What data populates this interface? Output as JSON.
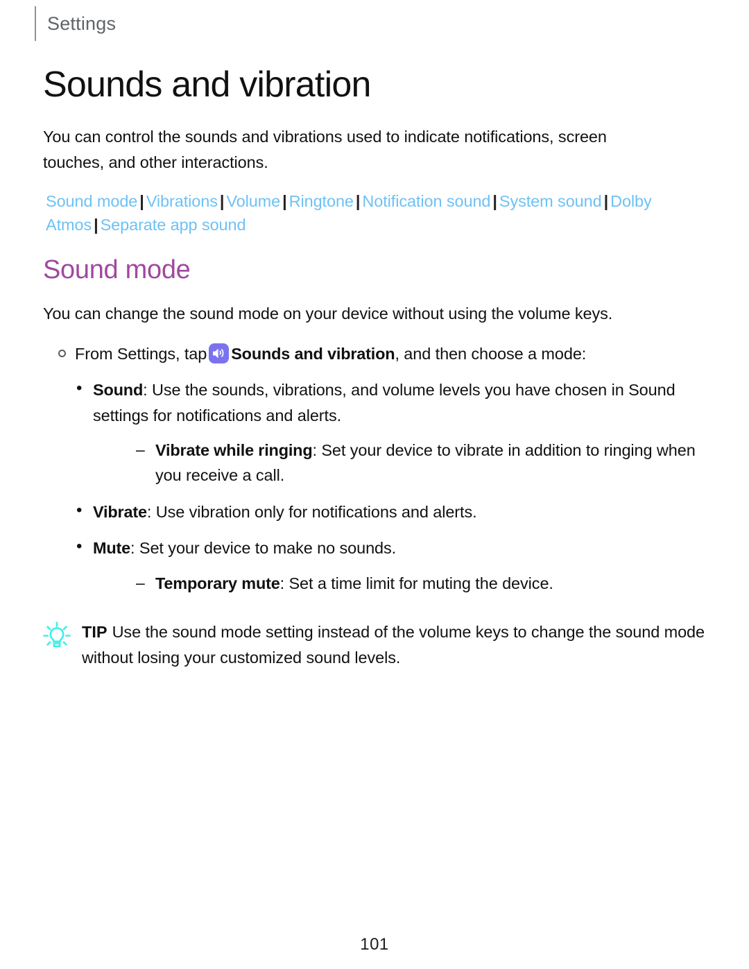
{
  "header": {
    "running_title": "Settings"
  },
  "page": {
    "title": "Sounds and vibration",
    "intro": "You can control the sounds and vibrations used to indicate notifications, screen touches, and other interactions.",
    "page_number": "101"
  },
  "section_links": {
    "separator": "|",
    "items": [
      {
        "label": "Sound mode"
      },
      {
        "label": "Vibrations"
      },
      {
        "label": "Volume"
      },
      {
        "label": "Ringtone"
      },
      {
        "label": "Notification sound"
      },
      {
        "label": "System sound"
      },
      {
        "label": "Dolby Atmos"
      },
      {
        "label": "Separate app sound"
      }
    ]
  },
  "section": {
    "heading": "Sound mode",
    "intro": "You can change the sound mode on your device without using the volume keys.",
    "step": {
      "prefix": "From Settings, tap",
      "icon_name": "sounds-and-vibration-icon",
      "bold_target": "Sounds and vibration",
      "suffix": ", and then choose a mode:"
    },
    "bullets": [
      {
        "term": "Sound",
        "text": ": Use the sounds, vibrations, and volume levels you have chosen in Sound settings for notifications and alerts.",
        "sub": [
          {
            "term": "Vibrate while ringing",
            "text": ": Set your device to vibrate in addition to ringing when you receive a call."
          }
        ]
      },
      {
        "term": "Vibrate",
        "text": ": Use vibration only for notifications and alerts.",
        "sub": []
      },
      {
        "term": "Mute",
        "text": ": Set your device to make no sounds.",
        "sub": [
          {
            "term": "Temporary mute",
            "text": ": Set a time limit for muting the device."
          }
        ]
      }
    ]
  },
  "tip": {
    "icon_name": "lightbulb-icon",
    "label": "TIP",
    "text": "Use the sound mode setting instead of the volume keys to change the sound mode without losing your customized sound levels."
  },
  "colors": {
    "link": "#6ec1f5",
    "section_heading": "#a0499f",
    "icon_badge": "#7b72f0",
    "tip_icon": "#3ef0e8",
    "running_header": "#5f6569"
  }
}
